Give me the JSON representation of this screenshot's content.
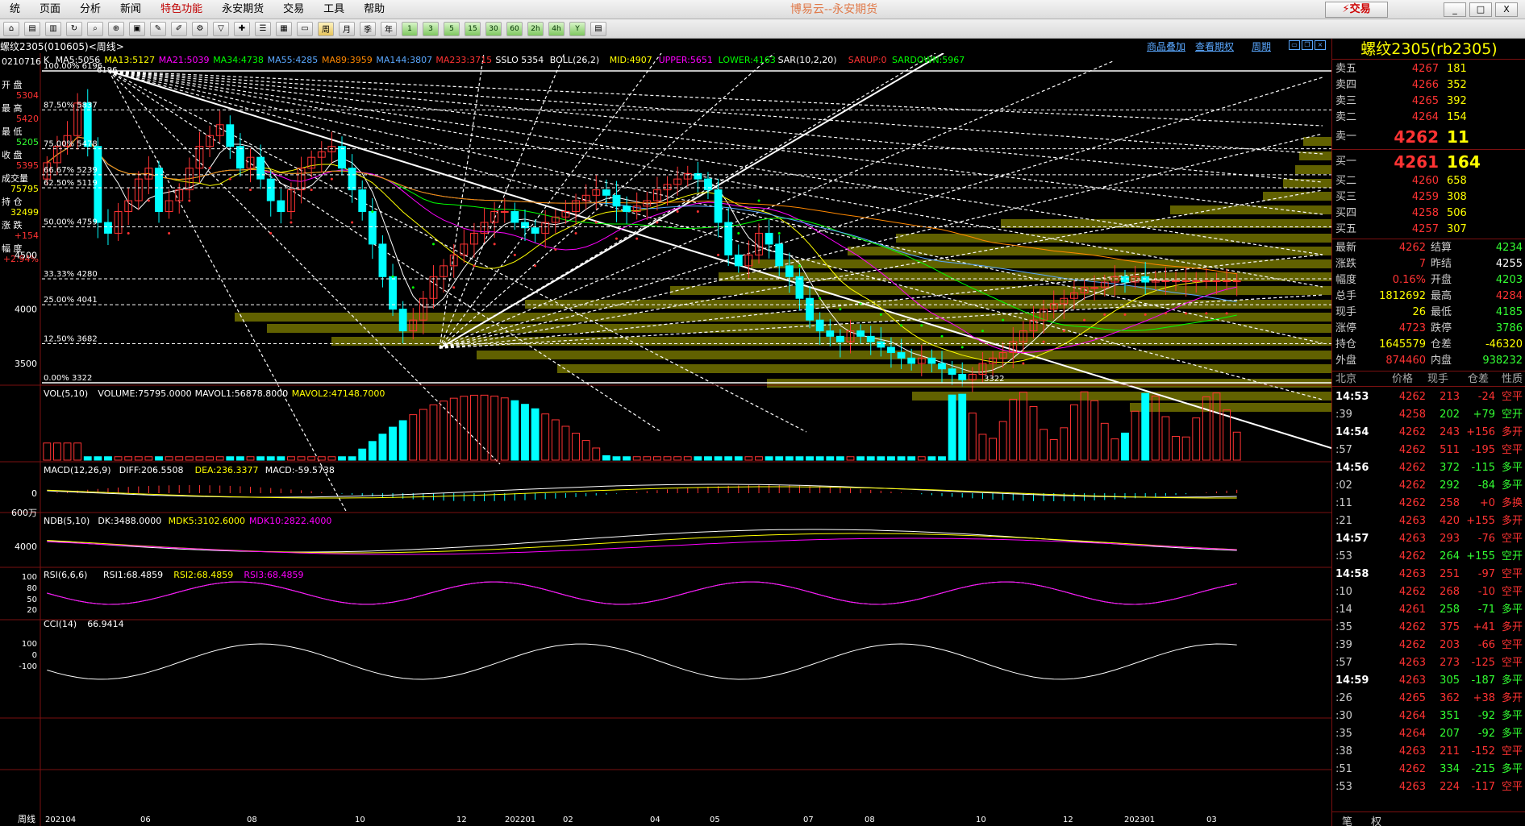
{
  "menubar": {
    "items": [
      "统",
      "页面",
      "分析",
      "新闻",
      "特色功能",
      "永安期货",
      "交易",
      "工具",
      "帮助"
    ],
    "active_index": 4,
    "title": "博易云--永安期货",
    "trade_label": "交易",
    "window_buttons": [
      "_",
      "□",
      "X"
    ]
  },
  "toolbar": {
    "period_buttons": [
      "周",
      "月",
      "季",
      "年",
      "1",
      "3",
      "5",
      "15",
      "30",
      "60",
      "2h",
      "4h",
      "Y"
    ]
  },
  "subbar": {
    "symbol": "螺纹2305(010605)<周线>",
    "links": [
      "商品叠加",
      "查看期权",
      "周期"
    ]
  },
  "indicators": {
    "main": [
      {
        "t": "K",
        "c": "#ffffff"
      },
      {
        "t": "MA5:5056",
        "c": "#ffffff"
      },
      {
        "t": "MA13:5127",
        "c": "#ffff00"
      },
      {
        "t": "MA21:5039",
        "c": "#ff00ff"
      },
      {
        "t": "MA34:4738",
        "c": "#00ff00"
      },
      {
        "t": "MA55:4285",
        "c": "#5aa8ff"
      },
      {
        "t": "MA89:3959",
        "c": "#ff8800"
      },
      {
        "t": "MA144:3807",
        "c": "#5aa8ff"
      },
      {
        "t": "MA233:3715",
        "c": "#ff3333"
      },
      {
        "t": "SSLO 5354",
        "c": "#ffffff"
      },
      {
        "t": "BOLL(26,2)",
        "c": "#ffffff"
      },
      {
        "t": "MID:4907",
        "c": "#ffff00"
      },
      {
        "t": "UPPER:5651",
        "c": "#ff00ff"
      },
      {
        "t": "LOWER:4163",
        "c": "#00ff00"
      },
      {
        "t": "SAR(10,2,20)",
        "c": "#ffffff"
      },
      {
        "t": "SARUP:0",
        "c": "#ff3333"
      },
      {
        "t": "SARDOWN:5967",
        "c": "#00ff00"
      }
    ],
    "vol": [
      {
        "t": "VOL(5,10)",
        "c": "#ffffff"
      },
      {
        "t": "VOLUME:75795.0000",
        "c": "#ffffff"
      },
      {
        "t": "MAVOL1:56878.8000",
        "c": "#ffffff"
      },
      {
        "t": "MAVOL2:47148.7000",
        "c": "#ffff00"
      }
    ],
    "macd": [
      {
        "t": "MACD(12,26,9)",
        "c": "#ffffff"
      },
      {
        "t": "DIFF:206.5508",
        "c": "#ffffff"
      },
      {
        "t": "DEA:236.3377",
        "c": "#ffff00"
      },
      {
        "t": "MACD:-59.5738",
        "c": "#ffffff"
      }
    ],
    "ndb": [
      {
        "t": "NDB(5,10)",
        "c": "#ffffff"
      },
      {
        "t": "DK:3488.0000",
        "c": "#ffffff"
      },
      {
        "t": "MDK5:3102.6000",
        "c": "#ffff00"
      },
      {
        "t": "MDK10:2822.4000",
        "c": "#ff00ff"
      }
    ],
    "rsi": [
      {
        "t": "RSI(6,6,6)",
        "c": "#ffffff"
      },
      {
        "t": "RSI1:68.4859",
        "c": "#ffffff"
      },
      {
        "t": "RSI2:68.4859",
        "c": "#ffff00"
      },
      {
        "t": "RSI3:68.4859",
        "c": "#ff00ff"
      }
    ],
    "cci": [
      {
        "t": "CCI(14)",
        "c": "#ffffff"
      },
      {
        "t": "66.9414",
        "c": "#ffffff"
      }
    ]
  },
  "left_info": [
    {
      "label": "0210716",
      "value": ""
    },
    {
      "label": "开 盘",
      "value": "5304"
    },
    {
      "label": "最 高",
      "value": "5420"
    },
    {
      "label": "最 低",
      "value": "5205"
    },
    {
      "label": "收 盘",
      "value": "5395"
    },
    {
      "label": "成交量",
      "value": "75795"
    },
    {
      "label": "持 仓",
      "value": "32499"
    },
    {
      "label": "涨 跌",
      "value": "+154"
    },
    {
      "label": "幅 度",
      "value": "+2.94%"
    }
  ],
  "price_axis": [
    "4500",
    "4000",
    "3500"
  ],
  "fib_levels": [
    {
      "label": "100.00%",
      "price": "6196"
    },
    {
      "label": "87.50%",
      "price": "5837"
    },
    {
      "label": "75.00%",
      "price": "5478"
    },
    {
      "label": "66.67%",
      "price": "5239"
    },
    {
      "label": "62.50%",
      "price": "5119"
    },
    {
      "label": "50.00%",
      "price": "4759"
    },
    {
      "label": "33.33%",
      "price": "4280"
    },
    {
      "label": "25.00%",
      "price": "4041"
    },
    {
      "label": "12.50%",
      "price": "3682"
    },
    {
      "label": "0.00%",
      "price": "3322"
    }
  ],
  "annotations": {
    "top_high": "6196",
    "low_mark": "3322"
  },
  "vol_axis": "600万",
  "macd_axis": "0",
  "ndb_axis": "4000",
  "rsi_axis": [
    "100",
    "80",
    "50",
    "20"
  ],
  "cci_axis": [
    "100",
    "0",
    "-100"
  ],
  "time_axis": {
    "period_label": "周线",
    "ticks": [
      "202104",
      "06",
      "08",
      "10",
      "12",
      "202201",
      "02",
      "04",
      "05",
      "07",
      "08",
      "10",
      "12",
      "202301",
      "03"
    ]
  },
  "quote": {
    "title": "螺纹2305(rb2305)",
    "asks": [
      {
        "label": "卖五",
        "price": "4267",
        "vol": "181"
      },
      {
        "label": "卖四",
        "price": "4266",
        "vol": "352"
      },
      {
        "label": "卖三",
        "price": "4265",
        "vol": "392"
      },
      {
        "label": "卖二",
        "price": "4264",
        "vol": "154"
      },
      {
        "label": "卖一",
        "price": "4262",
        "vol": "11"
      }
    ],
    "bids": [
      {
        "label": "买一",
        "price": "4261",
        "vol": "164"
      },
      {
        "label": "买二",
        "price": "4260",
        "vol": "658"
      },
      {
        "label": "买三",
        "price": "4259",
        "vol": "308"
      },
      {
        "label": "买四",
        "price": "4258",
        "vol": "506"
      },
      {
        "label": "买五",
        "price": "4257",
        "vol": "307"
      }
    ],
    "stats": [
      {
        "l1": "最新",
        "v1": "4262",
        "c1": "red",
        "l2": "结算",
        "v2": "4234",
        "c2": "green"
      },
      {
        "l1": "涨跌",
        "v1": "7",
        "c1": "red",
        "l2": "昨结",
        "v2": "4255",
        "c2": "white"
      },
      {
        "l1": "幅度",
        "v1": "0.16%",
        "c1": "red",
        "l2": "开盘",
        "v2": "4203",
        "c2": "green"
      },
      {
        "l1": "总手",
        "v1": "1812692",
        "c1": "yellow",
        "l2": "最高",
        "v2": "4284",
        "c2": "red"
      },
      {
        "l1": "现手",
        "v1": "26",
        "c1": "yellow",
        "l2": "最低",
        "v2": "4185",
        "c2": "green"
      },
      {
        "l1": "涨停",
        "v1": "4723",
        "c1": "red",
        "l2": "跌停",
        "v2": "3786",
        "c2": "green"
      },
      {
        "l1": "持仓",
        "v1": "1645579",
        "c1": "yellow",
        "l2": "仓差",
        "v2": "-46320",
        "c2": "yellow"
      },
      {
        "l1": "外盘",
        "v1": "874460",
        "c1": "red",
        "l2": "内盘",
        "v2": "938232",
        "c2": "green"
      }
    ],
    "ticks_header": [
      "北京",
      "价格",
      "现手",
      "仓差",
      "性质"
    ],
    "ticks": [
      {
        "t": "14:53",
        "b": true,
        "p": "4262",
        "v": "213",
        "vc": "red",
        "d": "-24",
        "dc": "red",
        "n": "空平",
        "nc": "red"
      },
      {
        "t": ":39",
        "b": false,
        "p": "4258",
        "v": "202",
        "vc": "green",
        "d": "+79",
        "dc": "green",
        "n": "空开",
        "nc": "green"
      },
      {
        "t": "14:54",
        "b": true,
        "p": "4262",
        "v": "243",
        "vc": "red",
        "d": "+156",
        "dc": "red",
        "n": "多开",
        "nc": "red"
      },
      {
        "t": ":57",
        "b": false,
        "p": "4262",
        "v": "511",
        "vc": "red",
        "d": "-195",
        "dc": "red",
        "n": "空平",
        "nc": "red"
      },
      {
        "t": "14:56",
        "b": true,
        "p": "4262",
        "v": "372",
        "vc": "green",
        "d": "-115",
        "dc": "green",
        "n": "多平",
        "nc": "green"
      },
      {
        "t": ":02",
        "b": false,
        "p": "4262",
        "v": "292",
        "vc": "green",
        "d": "-84",
        "dc": "green",
        "n": "多平",
        "nc": "green"
      },
      {
        "t": ":11",
        "b": false,
        "p": "4262",
        "v": "258",
        "vc": "red",
        "d": "+0",
        "dc": "red",
        "n": "多换",
        "nc": "red"
      },
      {
        "t": ":21",
        "b": false,
        "p": "4263",
        "v": "420",
        "vc": "red",
        "d": "+155",
        "dc": "red",
        "n": "多开",
        "nc": "red"
      },
      {
        "t": "14:57",
        "b": true,
        "p": "4263",
        "v": "293",
        "vc": "red",
        "d": "-76",
        "dc": "red",
        "n": "空平",
        "nc": "red"
      },
      {
        "t": ":53",
        "b": false,
        "p": "4262",
        "v": "264",
        "vc": "green",
        "d": "+155",
        "dc": "green",
        "n": "空开",
        "nc": "green"
      },
      {
        "t": "14:58",
        "b": true,
        "p": "4263",
        "v": "251",
        "vc": "red",
        "d": "-97",
        "dc": "red",
        "n": "空平",
        "nc": "red"
      },
      {
        "t": ":10",
        "b": false,
        "p": "4262",
        "v": "268",
        "vc": "red",
        "d": "-10",
        "dc": "red",
        "n": "空平",
        "nc": "red"
      },
      {
        "t": ":14",
        "b": false,
        "p": "4261",
        "v": "258",
        "vc": "green",
        "d": "-71",
        "dc": "green",
        "n": "多平",
        "nc": "green"
      },
      {
        "t": ":35",
        "b": false,
        "p": "4262",
        "v": "375",
        "vc": "red",
        "d": "+41",
        "dc": "red",
        "n": "多开",
        "nc": "red"
      },
      {
        "t": ":39",
        "b": false,
        "p": "4262",
        "v": "203",
        "vc": "red",
        "d": "-66",
        "dc": "red",
        "n": "空平",
        "nc": "red"
      },
      {
        "t": ":57",
        "b": false,
        "p": "4263",
        "v": "273",
        "vc": "red",
        "d": "-125",
        "dc": "red",
        "n": "空平",
        "nc": "red"
      },
      {
        "t": "14:59",
        "b": true,
        "p": "4263",
        "v": "305",
        "vc": "green",
        "d": "-187",
        "dc": "green",
        "n": "多平",
        "nc": "green"
      },
      {
        "t": ":26",
        "b": false,
        "p": "4265",
        "v": "362",
        "vc": "red",
        "d": "+38",
        "dc": "red",
        "n": "多开",
        "nc": "red"
      },
      {
        "t": ":30",
        "b": false,
        "p": "4264",
        "v": "351",
        "vc": "green",
        "d": "-92",
        "dc": "green",
        "n": "多平",
        "nc": "green"
      },
      {
        "t": ":35",
        "b": false,
        "p": "4264",
        "v": "207",
        "vc": "green",
        "d": "-92",
        "dc": "green",
        "n": "多平",
        "nc": "green"
      },
      {
        "t": ":38",
        "b": false,
        "p": "4263",
        "v": "211",
        "vc": "red",
        "d": "-152",
        "dc": "red",
        "n": "空平",
        "nc": "red"
      },
      {
        "t": ":51",
        "b": false,
        "p": "4262",
        "v": "334",
        "vc": "green",
        "d": "-215",
        "dc": "green",
        "n": "多平",
        "nc": "green"
      },
      {
        "t": ":53",
        "b": false,
        "p": "4263",
        "v": "224",
        "vc": "red",
        "d": "-117",
        "dc": "red",
        "n": "空平",
        "nc": "red"
      }
    ],
    "bottom_tabs": [
      "笔",
      "权"
    ]
  },
  "colors": {
    "up": "#ff3333",
    "down": "#00ffff",
    "ma_yellow": "#ffff00",
    "ma_magenta": "#ff00ff",
    "ma_green": "#00ff00",
    "ma_blue": "#5aa8ff",
    "ma_orange": "#ff8800",
    "volume_profile": "#6b6b00"
  }
}
